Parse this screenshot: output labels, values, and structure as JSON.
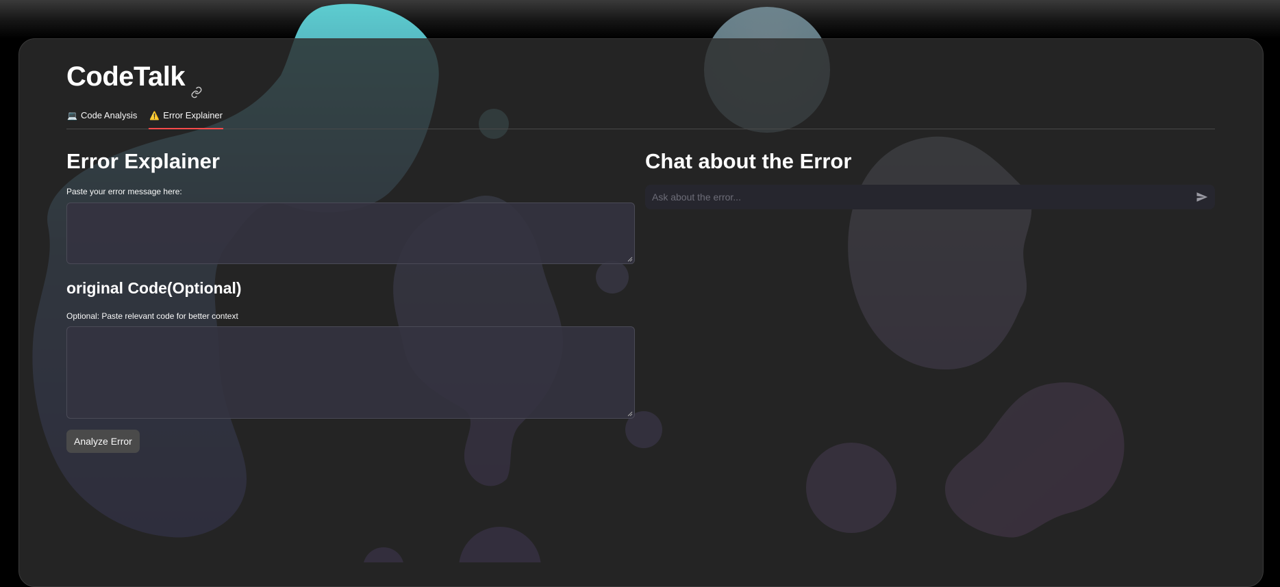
{
  "app": {
    "title": "CodeTalk"
  },
  "tabs": [
    {
      "icon": "💻",
      "label": "Code Analysis",
      "active": false
    },
    {
      "icon": "⚠️",
      "label": "Error Explainer",
      "active": true
    }
  ],
  "left": {
    "heading": "Error Explainer",
    "error_label": "Paste your error message here:",
    "error_value": "",
    "code_heading": "original Code(Optional)",
    "code_label": "Optional: Paste relevant code for better context",
    "code_value": "",
    "analyze_button": "Analyze Error"
  },
  "right": {
    "heading": "Chat about the Error",
    "chat_placeholder": "Ask about the error..."
  },
  "colors": {
    "accent_tab_underline": "#ff4b4b",
    "card_bg": "#2c2c2c",
    "input_bg": "#343340",
    "button_bg": "#4a4a4a"
  },
  "icons": {
    "title_link": "link-icon",
    "send": "send-icon",
    "tab_code_analysis": "laptop-icon",
    "tab_error_explainer": "warning-icon"
  }
}
